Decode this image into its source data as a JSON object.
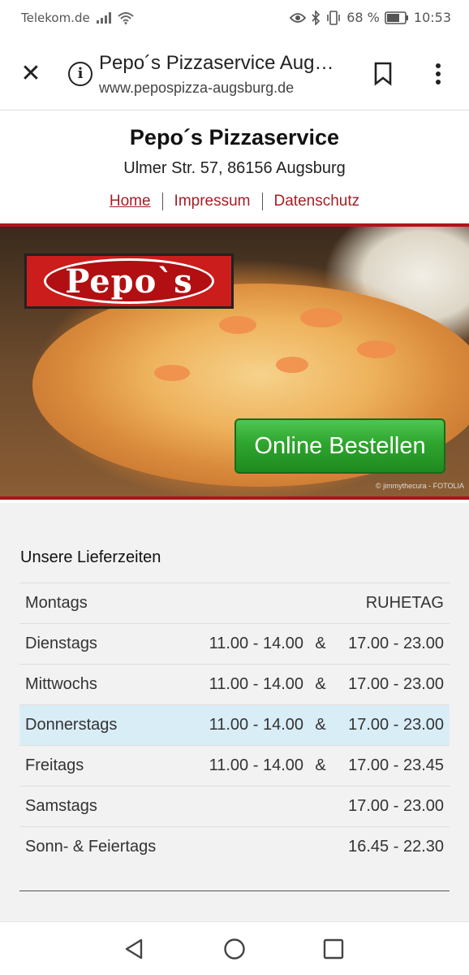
{
  "status_bar": {
    "carrier": "Telekom.de",
    "battery": "68 %",
    "time": "10:53"
  },
  "toolbar": {
    "title": "Pepo´s Pizzaservice Augsburg",
    "url": "www.pepospizza-augsburg.de"
  },
  "site": {
    "title": "Pepo´s Pizzaservice",
    "address": "Ulmer Str. 57, 86156 Augsburg",
    "nav": [
      "Home",
      "Impressum",
      "Datenschutz"
    ]
  },
  "hero": {
    "logo": "Pepo`s",
    "order_button": "Online Bestellen",
    "credit": "© jimmythecura - FOTOLIA"
  },
  "hours": {
    "title": "Unsere Lieferzeiten",
    "rows": [
      {
        "day": "Montags",
        "note": "RUHETAG"
      },
      {
        "day": "Dienstags",
        "t1": "11.00 - 14.00",
        "amp": "&",
        "t2": "17.00 - 23.00"
      },
      {
        "day": "Mittwochs",
        "t1": "11.00 - 14.00",
        "amp": "&",
        "t2": "17.00 - 23.00"
      },
      {
        "day": "Donnerstags",
        "t1": "11.00 - 14.00",
        "amp": "&",
        "t2": "17.00 - 23.00"
      },
      {
        "day": "Freitags",
        "t1": "11.00 - 14.00",
        "amp": "&",
        "t2": "17.00 - 23.45"
      },
      {
        "day": "Samstags",
        "t2": "17.00 - 23.00"
      },
      {
        "day": "Sonn- & Feiertags",
        "t2": "16.45 - 22.30"
      }
    ]
  }
}
